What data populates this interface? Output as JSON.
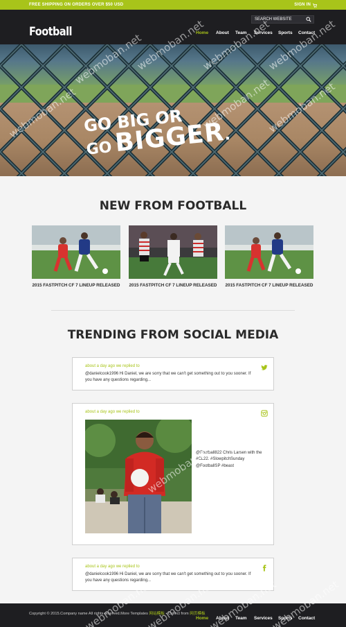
{
  "promo": {
    "message": "FREE SHIPPING ON ORDERS OVER $50 USD",
    "signin_label": "SIGN IN"
  },
  "header": {
    "logo": "Football",
    "search_placeholder": "SEARCH WEBSITE",
    "nav": [
      "Home",
      "Team",
      "Services",
      "Sports",
      "Contact"
    ],
    "nav_about": "About",
    "active_nav": "Home"
  },
  "hero": {
    "line1": "GO BIG OR",
    "line2": "GO",
    "line3": "BIGGER",
    "line3_suffix": ".",
    "active_slide": 1,
    "slide_count": 3
  },
  "news": {
    "title": "NEW FROM FOOTBALL",
    "cards": [
      {
        "caption": "2015 FASTPITCH CF 7 LINEUP RELEASED"
      },
      {
        "caption": "2015 FASTPITCH CF 7 LINEUP RELEASED"
      },
      {
        "caption": "2015 FASTPITCH CF 7 LINEUP RELEASED"
      }
    ]
  },
  "social": {
    "title": "TRENDING FROM SOCIAL MEDIA",
    "posts": [
      {
        "network": "twitter-icon",
        "meta": "about a day ago we replied to",
        "text": "@danielcook1996 Hi Daniel, we are sorry that we can't get something out to you sooner. If you have any questions regarding..."
      },
      {
        "network": "instagram-icon",
        "meta": "about a day ago we replied to",
        "text": "@Football822 Chris Larsen with the #CL22. #SlowpitchSunday @FootballSP #beast"
      },
      {
        "network": "facebook-icon",
        "meta": "about a day ago we replied to",
        "text": "@danielcook1996 Hi Daniel, we are sorry that we can't get something out to you sooner. If you have any questions regarding..."
      }
    ]
  },
  "footer": {
    "copyright": "Copyright © 2015.Company name All rights reserved.More Templates",
    "link1": "网站模板",
    "middle": " - Collect from ",
    "link2": "网页模板"
  },
  "watermark": "webmoban.net",
  "colors": {
    "accent": "#a8c41a",
    "dark": "#1e1e21",
    "background": "#f4f4f4"
  }
}
